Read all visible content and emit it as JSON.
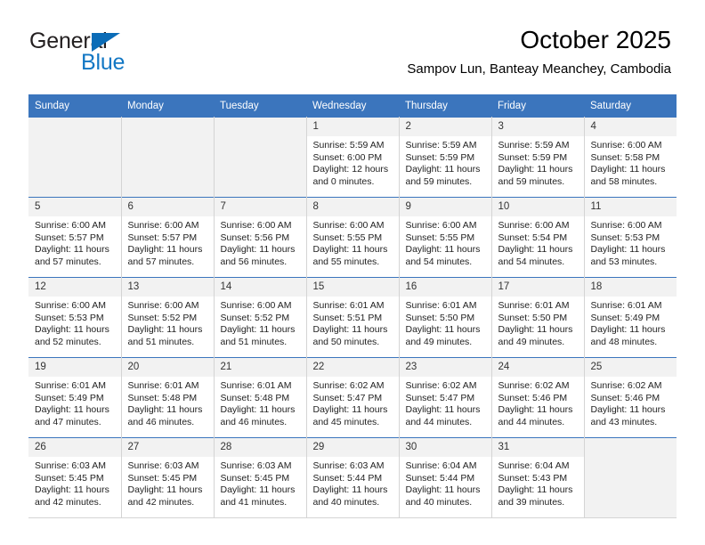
{
  "brand": {
    "word_one": "General",
    "word_two": "Blue",
    "triangle_color": "#0b6cb7",
    "blue_text_color": "#1277c4"
  },
  "header": {
    "title": "October 2025",
    "subtitle": "Sampov Lun, Banteay Meanchey, Cambodia",
    "header_bg": "#3b75bd"
  },
  "weekdays": [
    "Sunday",
    "Monday",
    "Tuesday",
    "Wednesday",
    "Thursday",
    "Friday",
    "Saturday"
  ],
  "weeks": [
    [
      {
        "day": "",
        "empty": true
      },
      {
        "day": "",
        "empty": true
      },
      {
        "day": "",
        "empty": true
      },
      {
        "day": "1",
        "sunrise": "Sunrise: 5:59 AM",
        "sunset": "Sunset: 6:00 PM",
        "daylight1": "Daylight: 12 hours",
        "daylight2": "and 0 minutes."
      },
      {
        "day": "2",
        "sunrise": "Sunrise: 5:59 AM",
        "sunset": "Sunset: 5:59 PM",
        "daylight1": "Daylight: 11 hours",
        "daylight2": "and 59 minutes."
      },
      {
        "day": "3",
        "sunrise": "Sunrise: 5:59 AM",
        "sunset": "Sunset: 5:59 PM",
        "daylight1": "Daylight: 11 hours",
        "daylight2": "and 59 minutes."
      },
      {
        "day": "4",
        "sunrise": "Sunrise: 6:00 AM",
        "sunset": "Sunset: 5:58 PM",
        "daylight1": "Daylight: 11 hours",
        "daylight2": "and 58 minutes."
      }
    ],
    [
      {
        "day": "5",
        "sunrise": "Sunrise: 6:00 AM",
        "sunset": "Sunset: 5:57 PM",
        "daylight1": "Daylight: 11 hours",
        "daylight2": "and 57 minutes."
      },
      {
        "day": "6",
        "sunrise": "Sunrise: 6:00 AM",
        "sunset": "Sunset: 5:57 PM",
        "daylight1": "Daylight: 11 hours",
        "daylight2": "and 57 minutes."
      },
      {
        "day": "7",
        "sunrise": "Sunrise: 6:00 AM",
        "sunset": "Sunset: 5:56 PM",
        "daylight1": "Daylight: 11 hours",
        "daylight2": "and 56 minutes."
      },
      {
        "day": "8",
        "sunrise": "Sunrise: 6:00 AM",
        "sunset": "Sunset: 5:55 PM",
        "daylight1": "Daylight: 11 hours",
        "daylight2": "and 55 minutes."
      },
      {
        "day": "9",
        "sunrise": "Sunrise: 6:00 AM",
        "sunset": "Sunset: 5:55 PM",
        "daylight1": "Daylight: 11 hours",
        "daylight2": "and 54 minutes."
      },
      {
        "day": "10",
        "sunrise": "Sunrise: 6:00 AM",
        "sunset": "Sunset: 5:54 PM",
        "daylight1": "Daylight: 11 hours",
        "daylight2": "and 54 minutes."
      },
      {
        "day": "11",
        "sunrise": "Sunrise: 6:00 AM",
        "sunset": "Sunset: 5:53 PM",
        "daylight1": "Daylight: 11 hours",
        "daylight2": "and 53 minutes."
      }
    ],
    [
      {
        "day": "12",
        "sunrise": "Sunrise: 6:00 AM",
        "sunset": "Sunset: 5:53 PM",
        "daylight1": "Daylight: 11 hours",
        "daylight2": "and 52 minutes."
      },
      {
        "day": "13",
        "sunrise": "Sunrise: 6:00 AM",
        "sunset": "Sunset: 5:52 PM",
        "daylight1": "Daylight: 11 hours",
        "daylight2": "and 51 minutes."
      },
      {
        "day": "14",
        "sunrise": "Sunrise: 6:00 AM",
        "sunset": "Sunset: 5:52 PM",
        "daylight1": "Daylight: 11 hours",
        "daylight2": "and 51 minutes."
      },
      {
        "day": "15",
        "sunrise": "Sunrise: 6:01 AM",
        "sunset": "Sunset: 5:51 PM",
        "daylight1": "Daylight: 11 hours",
        "daylight2": "and 50 minutes."
      },
      {
        "day": "16",
        "sunrise": "Sunrise: 6:01 AM",
        "sunset": "Sunset: 5:50 PM",
        "daylight1": "Daylight: 11 hours",
        "daylight2": "and 49 minutes."
      },
      {
        "day": "17",
        "sunrise": "Sunrise: 6:01 AM",
        "sunset": "Sunset: 5:50 PM",
        "daylight1": "Daylight: 11 hours",
        "daylight2": "and 49 minutes."
      },
      {
        "day": "18",
        "sunrise": "Sunrise: 6:01 AM",
        "sunset": "Sunset: 5:49 PM",
        "daylight1": "Daylight: 11 hours",
        "daylight2": "and 48 minutes."
      }
    ],
    [
      {
        "day": "19",
        "sunrise": "Sunrise: 6:01 AM",
        "sunset": "Sunset: 5:49 PM",
        "daylight1": "Daylight: 11 hours",
        "daylight2": "and 47 minutes."
      },
      {
        "day": "20",
        "sunrise": "Sunrise: 6:01 AM",
        "sunset": "Sunset: 5:48 PM",
        "daylight1": "Daylight: 11 hours",
        "daylight2": "and 46 minutes."
      },
      {
        "day": "21",
        "sunrise": "Sunrise: 6:01 AM",
        "sunset": "Sunset: 5:48 PM",
        "daylight1": "Daylight: 11 hours",
        "daylight2": "and 46 minutes."
      },
      {
        "day": "22",
        "sunrise": "Sunrise: 6:02 AM",
        "sunset": "Sunset: 5:47 PM",
        "daylight1": "Daylight: 11 hours",
        "daylight2": "and 45 minutes."
      },
      {
        "day": "23",
        "sunrise": "Sunrise: 6:02 AM",
        "sunset": "Sunset: 5:47 PM",
        "daylight1": "Daylight: 11 hours",
        "daylight2": "and 44 minutes."
      },
      {
        "day": "24",
        "sunrise": "Sunrise: 6:02 AM",
        "sunset": "Sunset: 5:46 PM",
        "daylight1": "Daylight: 11 hours",
        "daylight2": "and 44 minutes."
      },
      {
        "day": "25",
        "sunrise": "Sunrise: 6:02 AM",
        "sunset": "Sunset: 5:46 PM",
        "daylight1": "Daylight: 11 hours",
        "daylight2": "and 43 minutes."
      }
    ],
    [
      {
        "day": "26",
        "sunrise": "Sunrise: 6:03 AM",
        "sunset": "Sunset: 5:45 PM",
        "daylight1": "Daylight: 11 hours",
        "daylight2": "and 42 minutes."
      },
      {
        "day": "27",
        "sunrise": "Sunrise: 6:03 AM",
        "sunset": "Sunset: 5:45 PM",
        "daylight1": "Daylight: 11 hours",
        "daylight2": "and 42 minutes."
      },
      {
        "day": "28",
        "sunrise": "Sunrise: 6:03 AM",
        "sunset": "Sunset: 5:45 PM",
        "daylight1": "Daylight: 11 hours",
        "daylight2": "and 41 minutes."
      },
      {
        "day": "29",
        "sunrise": "Sunrise: 6:03 AM",
        "sunset": "Sunset: 5:44 PM",
        "daylight1": "Daylight: 11 hours",
        "daylight2": "and 40 minutes."
      },
      {
        "day": "30",
        "sunrise": "Sunrise: 6:04 AM",
        "sunset": "Sunset: 5:44 PM",
        "daylight1": "Daylight: 11 hours",
        "daylight2": "and 40 minutes."
      },
      {
        "day": "31",
        "sunrise": "Sunrise: 6:04 AM",
        "sunset": "Sunset: 5:43 PM",
        "daylight1": "Daylight: 11 hours",
        "daylight2": "and 39 minutes."
      },
      {
        "day": "",
        "empty": true
      }
    ]
  ]
}
